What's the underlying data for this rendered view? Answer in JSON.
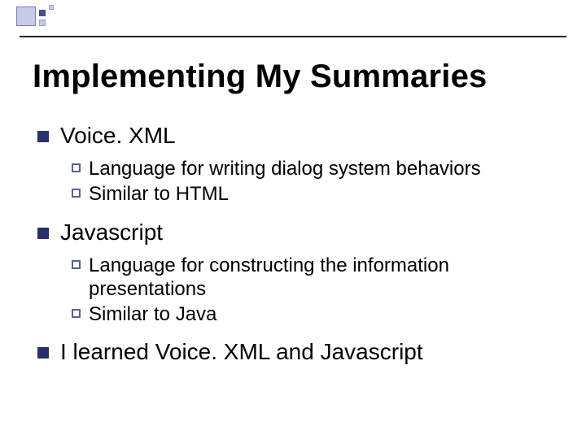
{
  "title": "Implementing My Summaries",
  "items": [
    {
      "label": "Voice. XML",
      "sub": [
        "Language for writing dialog system behaviors",
        "Similar to HTML"
      ]
    },
    {
      "label": "Javascript",
      "sub": [
        "Language for constructing the information presentations",
        "Similar to Java"
      ]
    },
    {
      "label": "I learned Voice. XML and Javascript",
      "sub": []
    }
  ]
}
